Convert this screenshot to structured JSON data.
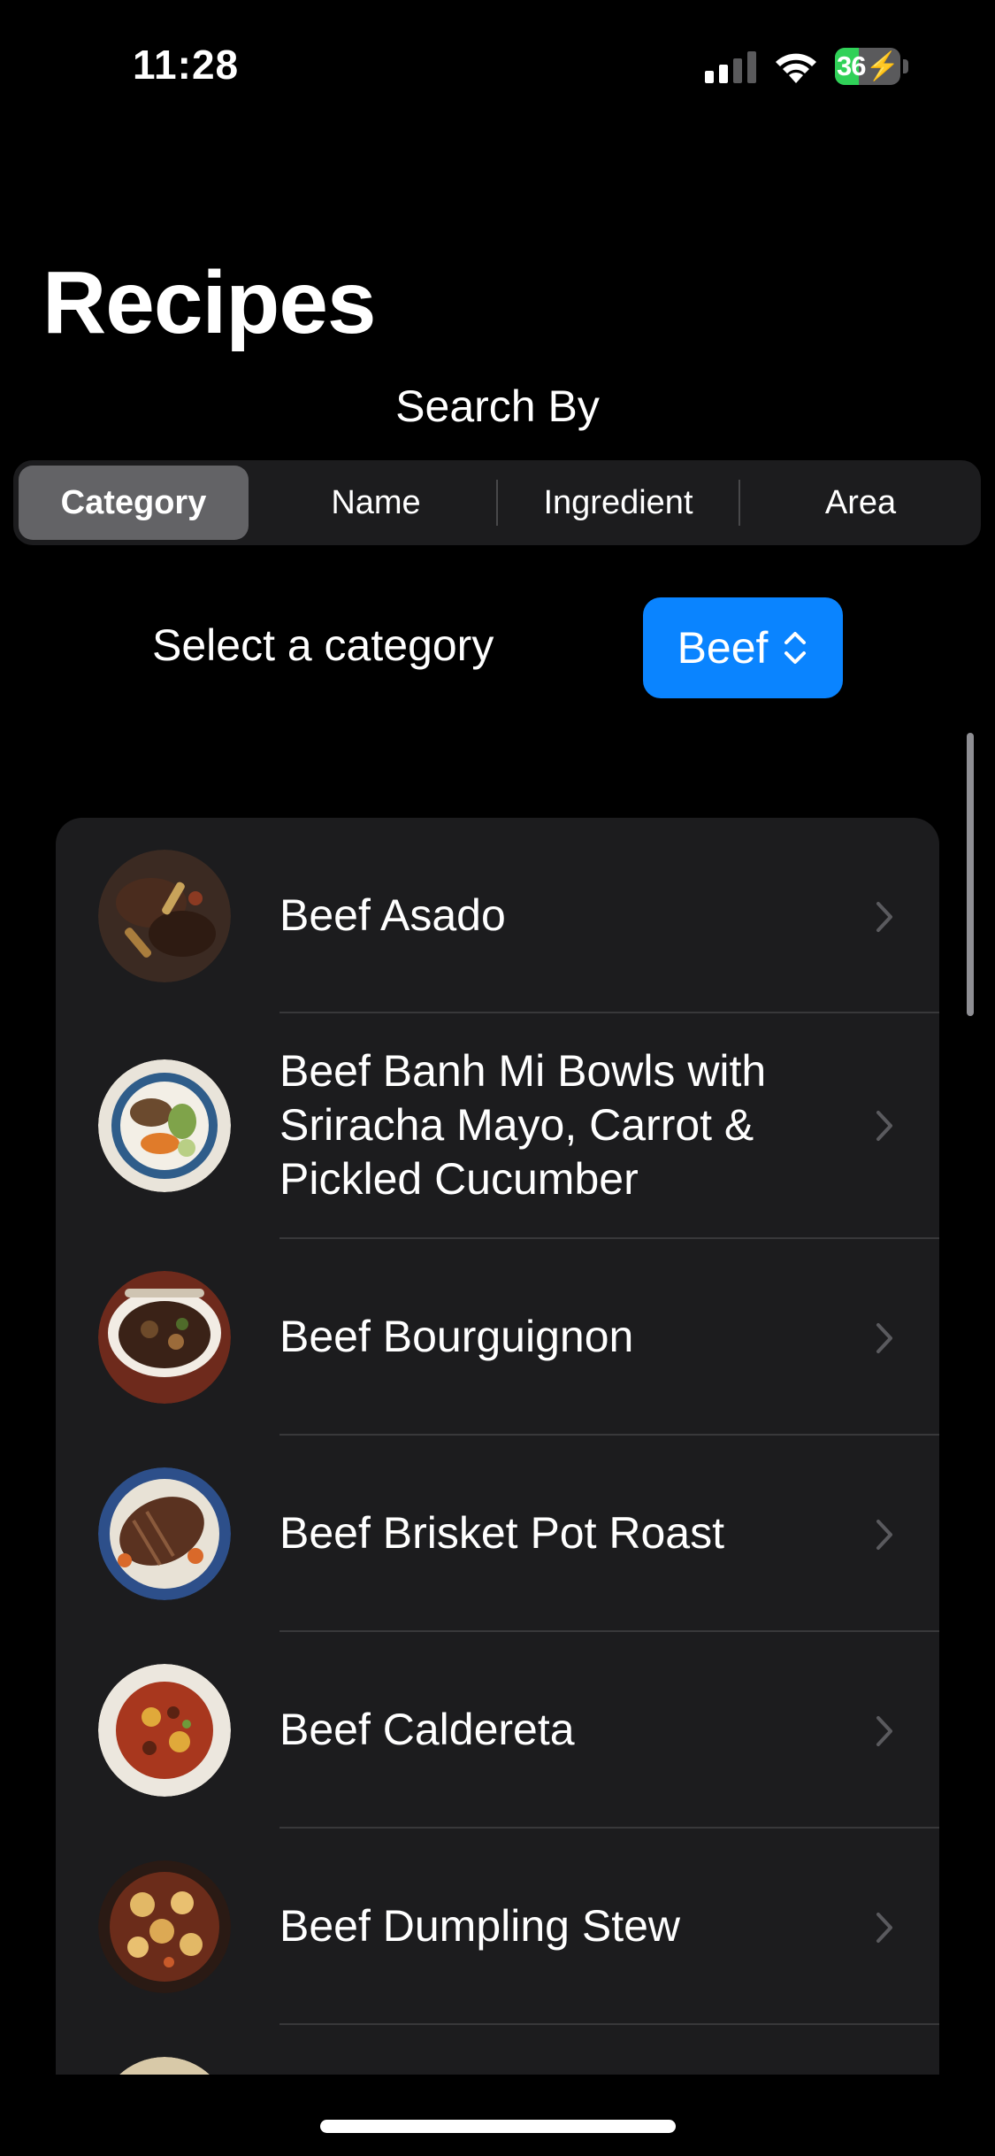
{
  "status_bar": {
    "time": "11:28",
    "battery_text": "36",
    "battery_level": 0.36
  },
  "header": {
    "title": "Recipes",
    "search_by_label": "Search By"
  },
  "segments": [
    {
      "label": "Category",
      "selected": true
    },
    {
      "label": "Name",
      "selected": false
    },
    {
      "label": "Ingredient",
      "selected": false
    },
    {
      "label": "Area",
      "selected": false
    }
  ],
  "picker": {
    "label": "Select a category",
    "value": "Beef"
  },
  "recipes": [
    {
      "title": "Beef Asado"
    },
    {
      "title": "Beef Banh Mi Bowls with Sriracha Mayo, Carrot & Pickled Cucumber"
    },
    {
      "title": "Beef Bourguignon"
    },
    {
      "title": "Beef Brisket Pot Roast"
    },
    {
      "title": "Beef Caldereta"
    },
    {
      "title": "Beef Dumpling Stew"
    },
    {
      "title": ""
    }
  ],
  "colors": {
    "accent": "#0a84ff",
    "battery_green": "#30d158",
    "list_background": "#1c1c1e"
  }
}
